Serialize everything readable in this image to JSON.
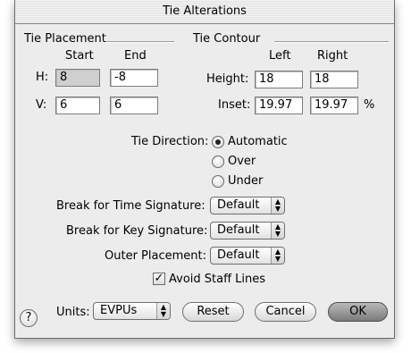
{
  "window": {
    "title": "Tie Alterations"
  },
  "placement": {
    "heading": "Tie Placement",
    "col_start": "Start",
    "col_end": "End",
    "h_label": "H:",
    "v_label": "V:",
    "h_start": "8",
    "h_end": "-8",
    "v_start": "6",
    "v_end": "6"
  },
  "contour": {
    "heading": "Tie Contour",
    "col_left": "Left",
    "col_right": "Right",
    "height_label": "Height:",
    "inset_label": "Inset:",
    "height_left": "18",
    "height_right": "18",
    "inset_left": "19.97",
    "inset_right": "19.97",
    "percent": "%"
  },
  "direction": {
    "label": "Tie Direction:",
    "options": [
      "Automatic",
      "Over",
      "Under"
    ],
    "selected": "Automatic"
  },
  "break_time": {
    "label": "Break for Time Signature:",
    "value": "Default"
  },
  "break_key": {
    "label": "Break for Key Signature:",
    "value": "Default"
  },
  "outer": {
    "label": "Outer Placement:",
    "value": "Default"
  },
  "avoid": {
    "label": "Avoid Staff Lines",
    "checked": true,
    "mark": "✓"
  },
  "footer": {
    "help": "?",
    "units_label": "Units:",
    "units_value": "EVPUs",
    "reset": "Reset",
    "cancel": "Cancel",
    "ok": "OK"
  },
  "icons": {
    "popup_arrows": "▲▼",
    "help": "help-icon"
  }
}
